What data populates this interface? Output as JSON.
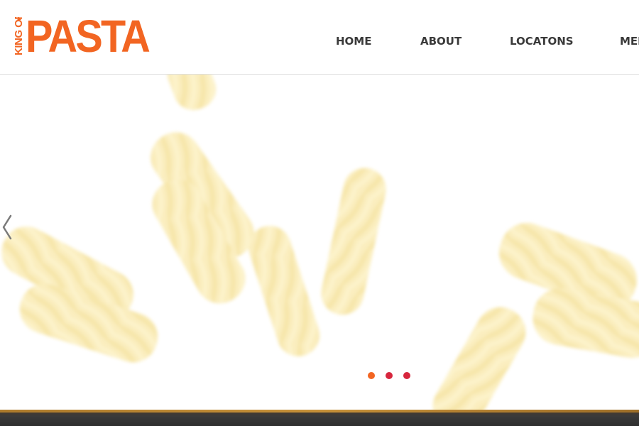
{
  "brand": {
    "logo_main": "PASTA",
    "logo_prefix": "KING OF",
    "color": "#f26522"
  },
  "nav": {
    "items": [
      {
        "label": "HOME"
      },
      {
        "label": "ABOUT"
      },
      {
        "label": "LOCATONS"
      },
      {
        "label": "MENU"
      }
    ]
  },
  "slider": {
    "prev_icon": "chevron-left-icon",
    "dots": [
      {
        "color": "#f26522",
        "active": true
      },
      {
        "color": "#d7263d",
        "active": false
      },
      {
        "color": "#d7263d",
        "active": false
      }
    ]
  },
  "colors": {
    "pasta": "#f5d86a",
    "nav_text": "#3a3a3a"
  }
}
